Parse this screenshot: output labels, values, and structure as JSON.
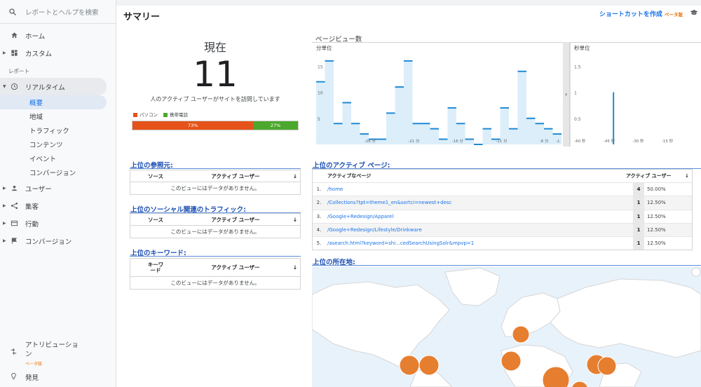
{
  "sidebar": {
    "search_placeholder": "レポートとヘルプを検索",
    "home": "ホーム",
    "custom": "カスタム",
    "reports_section": "レポート",
    "realtime": "リアルタイム",
    "realtime_items": [
      "概要",
      "地域",
      "トラフィック",
      "コンテンツ",
      "イベント",
      "コンバージョン"
    ],
    "audience": "ユーザー",
    "acquisition": "集客",
    "behavior": "行動",
    "conversions": "コンバージョン",
    "attribution_1": "アトリビューショ",
    "attribution_2": "ン",
    "attribution_beta": "ベータ版",
    "discover": "発見"
  },
  "header": {
    "title": "サマリー",
    "shortcut": "ショートカットを作成",
    "shortcut_beta": "ベータ版"
  },
  "current": {
    "label": "現在",
    "count": "11",
    "description": "人のアクティブ ユーザーがサイトを訪問しています",
    "legend_desktop": "パソコン",
    "legend_mobile": "携帯電話",
    "desktop_pct_label": "73%",
    "mobile_pct_label": "27%",
    "desktop_share": 0.73,
    "colors": {
      "desktop": "#e5531a",
      "mobile": "#4ca82c"
    }
  },
  "referrals": {
    "title": "上位の参照元:",
    "col_source": "ソース",
    "col_users": "アクティブ ユーザー",
    "empty": "このビューにはデータがありません。"
  },
  "social": {
    "title": "上位のソーシャル関連のトラフィック:",
    "col_source": "ソース",
    "col_users": "アクティブ ユーザー",
    "empty": "このビューにはデータがありません。"
  },
  "keywords": {
    "title": "上位のキーワード:",
    "col_keyword_1": "キーワ",
    "col_keyword_2": "ード",
    "col_users": "アクティブ ユーザー",
    "empty": "このビューにはデータがありません。"
  },
  "pageviews": {
    "title": "ページビュー数",
    "per_minute": "分単位",
    "per_second": "秒単位"
  },
  "chart_data": [
    {
      "type": "bar",
      "title": "分単位",
      "y_ticks": [
        "15",
        "10",
        "5"
      ],
      "x_ticks": [
        "-26 分",
        "-21 分",
        "-16 分",
        "-11 分",
        "-6 分",
        "-1"
      ],
      "ylim": [
        0,
        18
      ],
      "values": [
        12,
        16,
        4,
        8,
        4,
        2,
        1,
        1,
        6,
        11,
        16,
        4,
        4,
        3,
        1,
        7,
        4,
        1,
        0,
        3,
        1,
        7,
        3,
        14,
        5,
        4,
        3,
        2
      ]
    },
    {
      "type": "bar",
      "title": "秒単位",
      "y_ticks": [
        "1.5",
        "1",
        "0.5"
      ],
      "x_ticks": [
        "-60 秒",
        "-45 秒",
        "-30 秒",
        "-15 秒"
      ],
      "ylim": [
        0,
        1.8
      ],
      "values": [
        {
          "x": -42,
          "y": 1
        }
      ]
    }
  ],
  "active_pages": {
    "title": "上位のアクティブ ページ:",
    "col_page": "アクティブなページ",
    "col_users": "アクティブ ユーザー",
    "rows": [
      {
        "idx": "1.",
        "page": "/home",
        "count": "4",
        "pct": "50.00%"
      },
      {
        "idx": "2.",
        "page": "/Collections?tpt=theme1_en&sortci=newest+desc",
        "count": "1",
        "pct": "12.50%"
      },
      {
        "idx": "3.",
        "page": "/Google+Redesign/Apparel",
        "count": "1",
        "pct": "12.50%"
      },
      {
        "idx": "4.",
        "page": "/Google+Redesign/Lifestyle/Drinkware",
        "count": "1",
        "pct": "12.50%"
      },
      {
        "idx": "5.",
        "page": "/asearch.html?keyword=shi...cedSearchUsingSolr&mpvp=1",
        "count": "1",
        "pct": "12.50%"
      }
    ]
  },
  "locations": {
    "title": "上位の所在地:"
  }
}
